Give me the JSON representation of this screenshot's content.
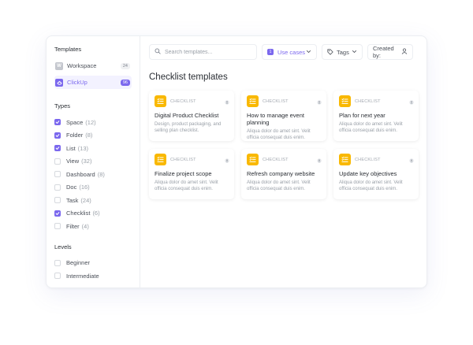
{
  "sidebar": {
    "templates_heading": "Templates",
    "templates": [
      {
        "label": "Workspace",
        "count": "24",
        "icon": "W",
        "active": false
      },
      {
        "label": "ClickUp",
        "count": "96",
        "icon": "clickup-logo",
        "active": true
      }
    ],
    "types_heading": "Types",
    "types": [
      {
        "label": "Space",
        "count": "(12)",
        "checked": true
      },
      {
        "label": "Folder",
        "count": "(8)",
        "checked": true
      },
      {
        "label": "List",
        "count": "(13)",
        "checked": true
      },
      {
        "label": "View",
        "count": "(32)",
        "checked": false
      },
      {
        "label": "Dashboard",
        "count": "(8)",
        "checked": false
      },
      {
        "label": "Doc",
        "count": "(16)",
        "checked": false
      },
      {
        "label": "Task",
        "count": "(24)",
        "checked": false
      },
      {
        "label": "Checklist",
        "count": "(6)",
        "checked": true
      },
      {
        "label": "Filter",
        "count": "(4)",
        "checked": false
      }
    ],
    "levels_heading": "Levels",
    "levels": [
      {
        "label": "Beginner",
        "checked": false
      },
      {
        "label": "Intermediate",
        "checked": false
      }
    ]
  },
  "toolbar": {
    "search_placeholder": "Search templates...",
    "use_cases_label": "Use cases",
    "use_cases_badge": "1",
    "tags_label": "Tags",
    "created_by_label": "Created by:"
  },
  "main": {
    "section_title": "Checklist templates",
    "cards": [
      {
        "category": "CHECKLIST",
        "title": "Digital Product Checklist",
        "desc": "Design, product packaging, and selling plan checklist."
      },
      {
        "category": "CHECKLIST",
        "title": "How to manage event planning",
        "desc": "Aliqua dolor do amet sint. Velit officia consequat duis enim."
      },
      {
        "category": "CHECKLIST",
        "title": "Plan for next year",
        "desc": "Aliqua dolor do amet sint. Velit officia consequat duis enim."
      },
      {
        "category": "CHECKLIST",
        "title": "Finalize project scope",
        "desc": "Aliqua dolor do amet sint. Velit officia consequat duis enim."
      },
      {
        "category": "CHECKLIST",
        "title": "Refresh company website",
        "desc": "Aliqua dolor do amet sint. Velit officia consequat duis enim."
      },
      {
        "category": "CHECKLIST",
        "title": "Update key objectives",
        "desc": "Aliqua dolor do amet sint. Velit officia consequat duis enim."
      }
    ]
  },
  "colors": {
    "accent": "#7b68ee",
    "checklist_icon": "#f9b800"
  }
}
